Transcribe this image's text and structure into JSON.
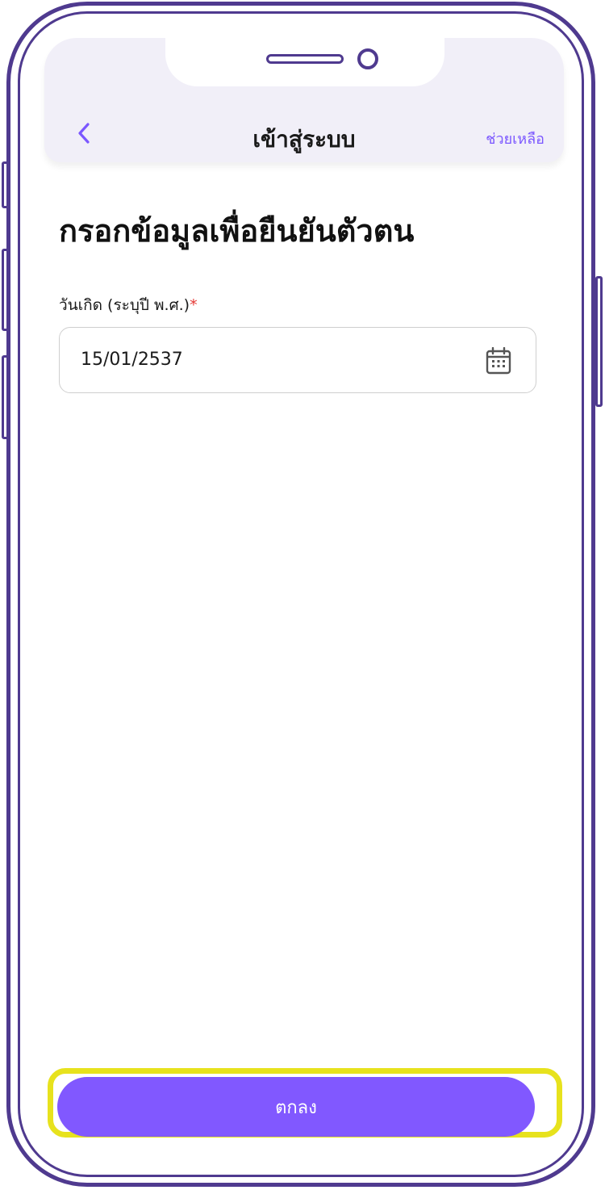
{
  "header": {
    "title": "เข้าสู่ระบบ",
    "help_label": "ช่วยเหลือ",
    "back_icon": "chevron-left-icon"
  },
  "main": {
    "heading": "กรอกข้อมูลเพื่อยืนยันตัวตน",
    "birthdate_label": "วันเกิด (ระบุปี พ.ศ.)",
    "required_mark": "*",
    "birthdate_value": "15/01/2537",
    "calendar_icon": "calendar-icon"
  },
  "footer": {
    "confirm_label": "ตกลง"
  },
  "colors": {
    "accent": "#8158ff",
    "header_bg": "#f1eff8",
    "frame": "#4f3a8f",
    "highlight": "#e7e21d",
    "required": "#e53935"
  }
}
